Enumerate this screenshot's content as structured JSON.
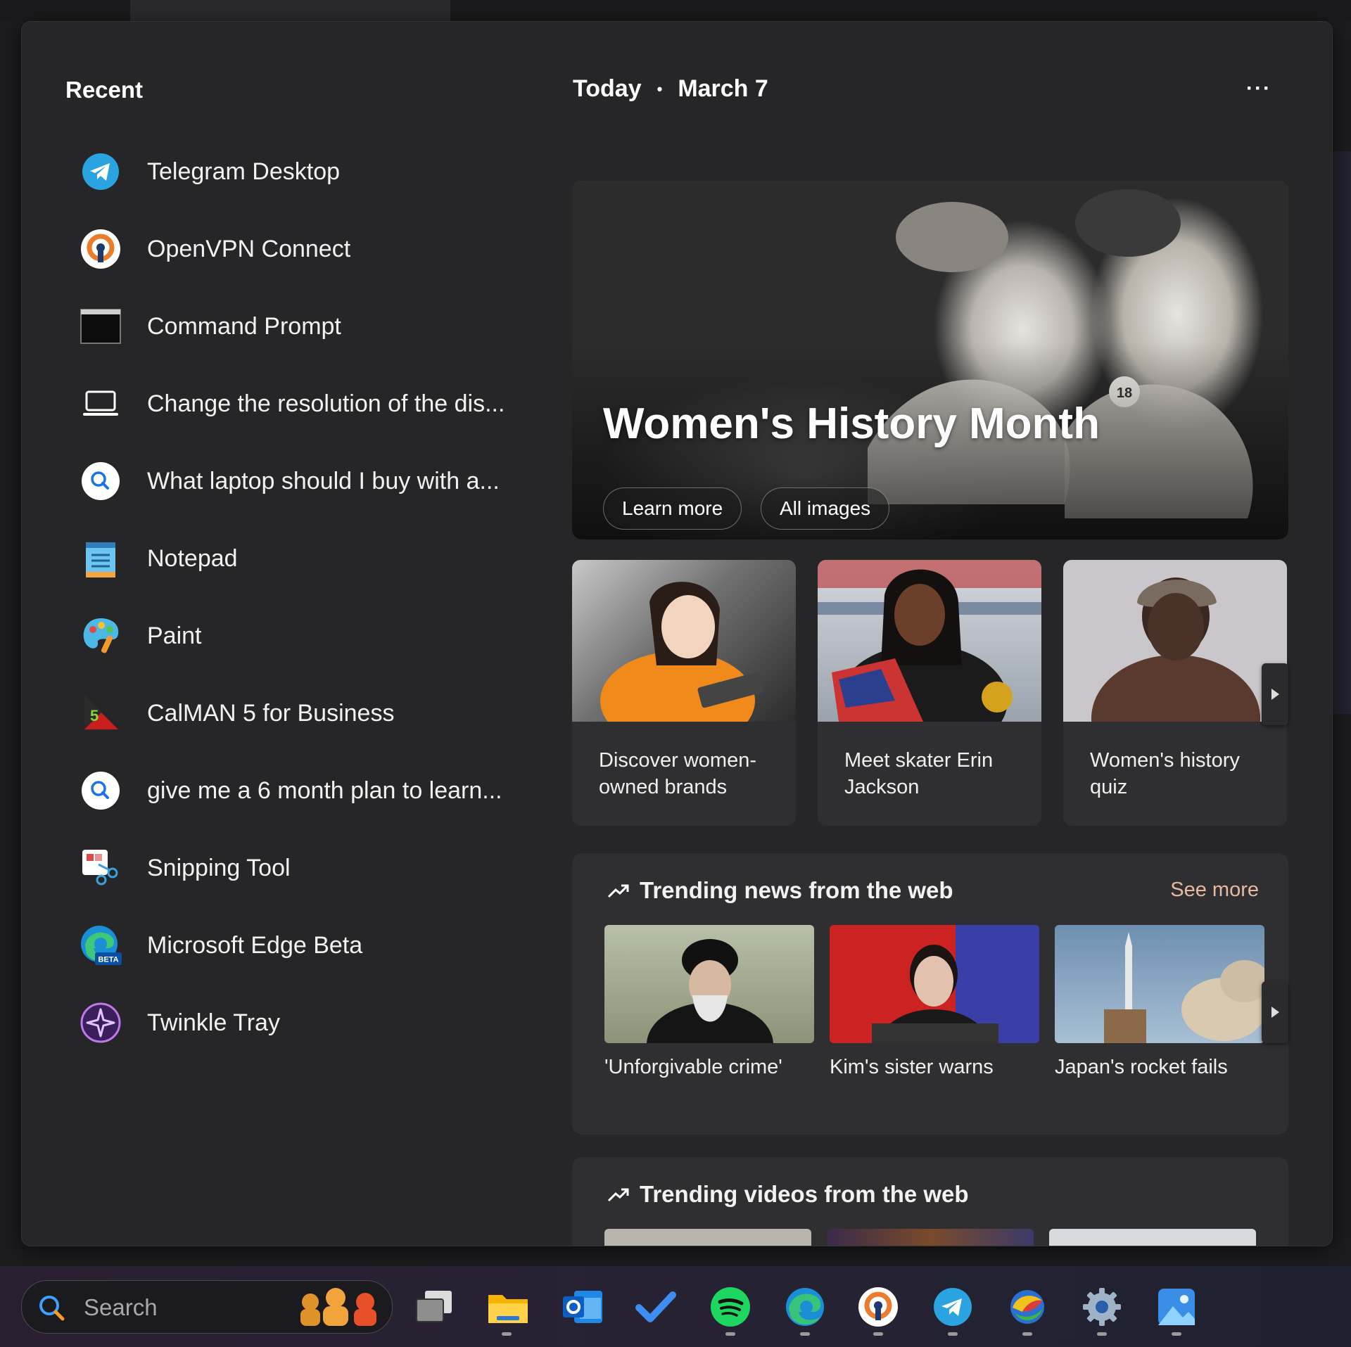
{
  "recent": {
    "title": "Recent",
    "items": [
      {
        "label": "Telegram Desktop",
        "icon": "telegram-icon"
      },
      {
        "label": "OpenVPN Connect",
        "icon": "openvpn-icon"
      },
      {
        "label": "Command Prompt",
        "icon": "command-prompt-icon"
      },
      {
        "label": "Change the resolution of the dis...",
        "icon": "laptop-display-icon"
      },
      {
        "label": "What laptop should I buy with a...",
        "icon": "search-icon"
      },
      {
        "label": "Notepad",
        "icon": "notepad-icon"
      },
      {
        "label": "Paint",
        "icon": "paint-palette-icon"
      },
      {
        "label": "CalMAN 5 for Business",
        "icon": "calman-icon"
      },
      {
        "label": "give me a 6 month plan to learn...",
        "icon": "search-icon"
      },
      {
        "label": "Snipping Tool",
        "icon": "snipping-tool-icon"
      },
      {
        "label": "Microsoft Edge Beta",
        "icon": "edge-beta-icon"
      },
      {
        "label": "Twinkle Tray",
        "icon": "twinkle-tray-icon"
      }
    ]
  },
  "today": {
    "label": "Today",
    "separator": "•",
    "date": "March 7",
    "more": "···"
  },
  "hero": {
    "title": "Women's History Month",
    "buttons": [
      "Learn more",
      "All images"
    ],
    "badge": "18"
  },
  "cards": [
    {
      "caption": "Discover women-owned brands"
    },
    {
      "caption": "Meet skater Erin Jackson"
    },
    {
      "caption": "Women's history quiz"
    }
  ],
  "trending_news": {
    "title": "Trending news from the web",
    "see_more": "See more",
    "items": [
      {
        "caption": "'Unforgivable crime'"
      },
      {
        "caption": "Kim's sister warns"
      },
      {
        "caption": "Japan's rocket fails"
      }
    ]
  },
  "trending_videos": {
    "title": "Trending videos from the web"
  },
  "edge_beta_badge": "BETA",
  "taskbar": {
    "search_placeholder": "Search",
    "apps": [
      "task-view-icon",
      "file-explorer-icon",
      "outlook-icon",
      "todo-icon",
      "spotify-icon",
      "edge-icon",
      "openvpn-icon",
      "telegram-icon",
      "colorful-globe-icon",
      "settings-icon",
      "photos-icon"
    ]
  },
  "colors": {
    "panel": "#262628",
    "accent_link": "#e7b9a0",
    "card": "#2f2f31"
  }
}
